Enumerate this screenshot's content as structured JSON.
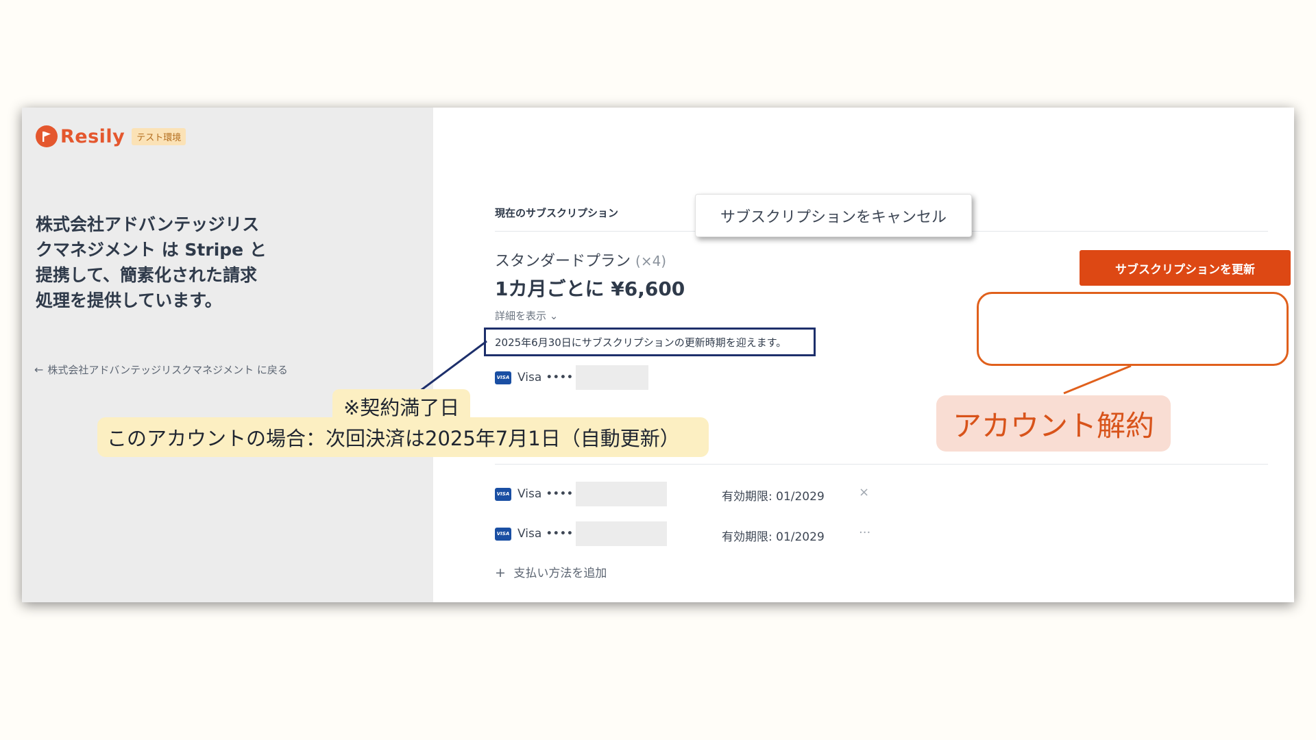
{
  "brand": {
    "name": "Resily",
    "env_badge": "テスト環境"
  },
  "left_panel": {
    "company_description": "株式会社アドバンテッジリスクマネジメント は Stripe と提携して、簡素化された請求処理を提供しています。",
    "back_link": "株式会社アドバンテッジリスクマネジメント に戻る"
  },
  "subscription": {
    "section_title": "現在のサブスクリプション",
    "plan_name": "スタンダードプラン",
    "plan_quantity": "(×4)",
    "price": "1カ月ごとに ¥6,600",
    "details_toggle": "詳細を表示",
    "renewal_note": "2025年6月30日にサブスクリプションの更新時期を迎えます。",
    "card": {
      "brand": "Visa",
      "mask": "••••"
    },
    "update_button": "サブスクリプションを更新",
    "cancel_button": "サブスクリプションをキャンセル"
  },
  "payment_methods": {
    "cards": [
      {
        "brand": "Visa",
        "mask": "••••",
        "expiry": "有効期限: 01/2029",
        "action": "×"
      },
      {
        "brand": "Visa",
        "mask": "••••",
        "expiry": "有効期限: 01/2029",
        "action": "···"
      }
    ],
    "add_label": "支払い方法を追加"
  },
  "annotations": {
    "account_cancel": "アカウント解約",
    "expiry_label": "※契約満了日",
    "next_payment_label": "このアカウントの場合：次回決済は2025年7月1日（自動更新）"
  },
  "colors": {
    "brand": "#e4572e",
    "primary_button": "#dd4814",
    "annotation_orange": "#e0601c",
    "annotation_navy": "#1d2f6b",
    "annotation_yellow": "#fcefc2",
    "annotation_pink": "#f9ddd3",
    "visa": "#1a4fa3"
  }
}
